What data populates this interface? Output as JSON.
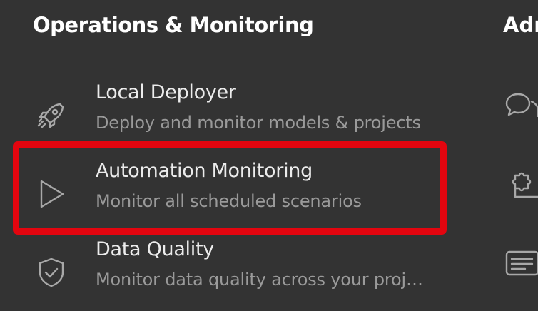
{
  "section": {
    "title": "Operations & Monitoring"
  },
  "right_section": {
    "title_fragment": "Adr"
  },
  "items": [
    {
      "label": "Local Deployer",
      "description": "Deploy and monitor models & projects",
      "icon": "rocket-icon"
    },
    {
      "label": "Automation Monitoring",
      "description": "Monitor all scheduled scenarios",
      "icon": "play-icon"
    },
    {
      "label": "Data Quality",
      "description": "Monitor data quality across your proj…",
      "icon": "shield-check-icon"
    }
  ],
  "right_icons": [
    "chat-bubbles-icon",
    "puzzle-icon",
    "id-card-icon"
  ],
  "colors": {
    "background": "#333333",
    "highlight": "#e3050f",
    "title": "#ffffff",
    "label": "#ececec",
    "description": "#9a9a9a",
    "icon": "#a8a8a8"
  }
}
